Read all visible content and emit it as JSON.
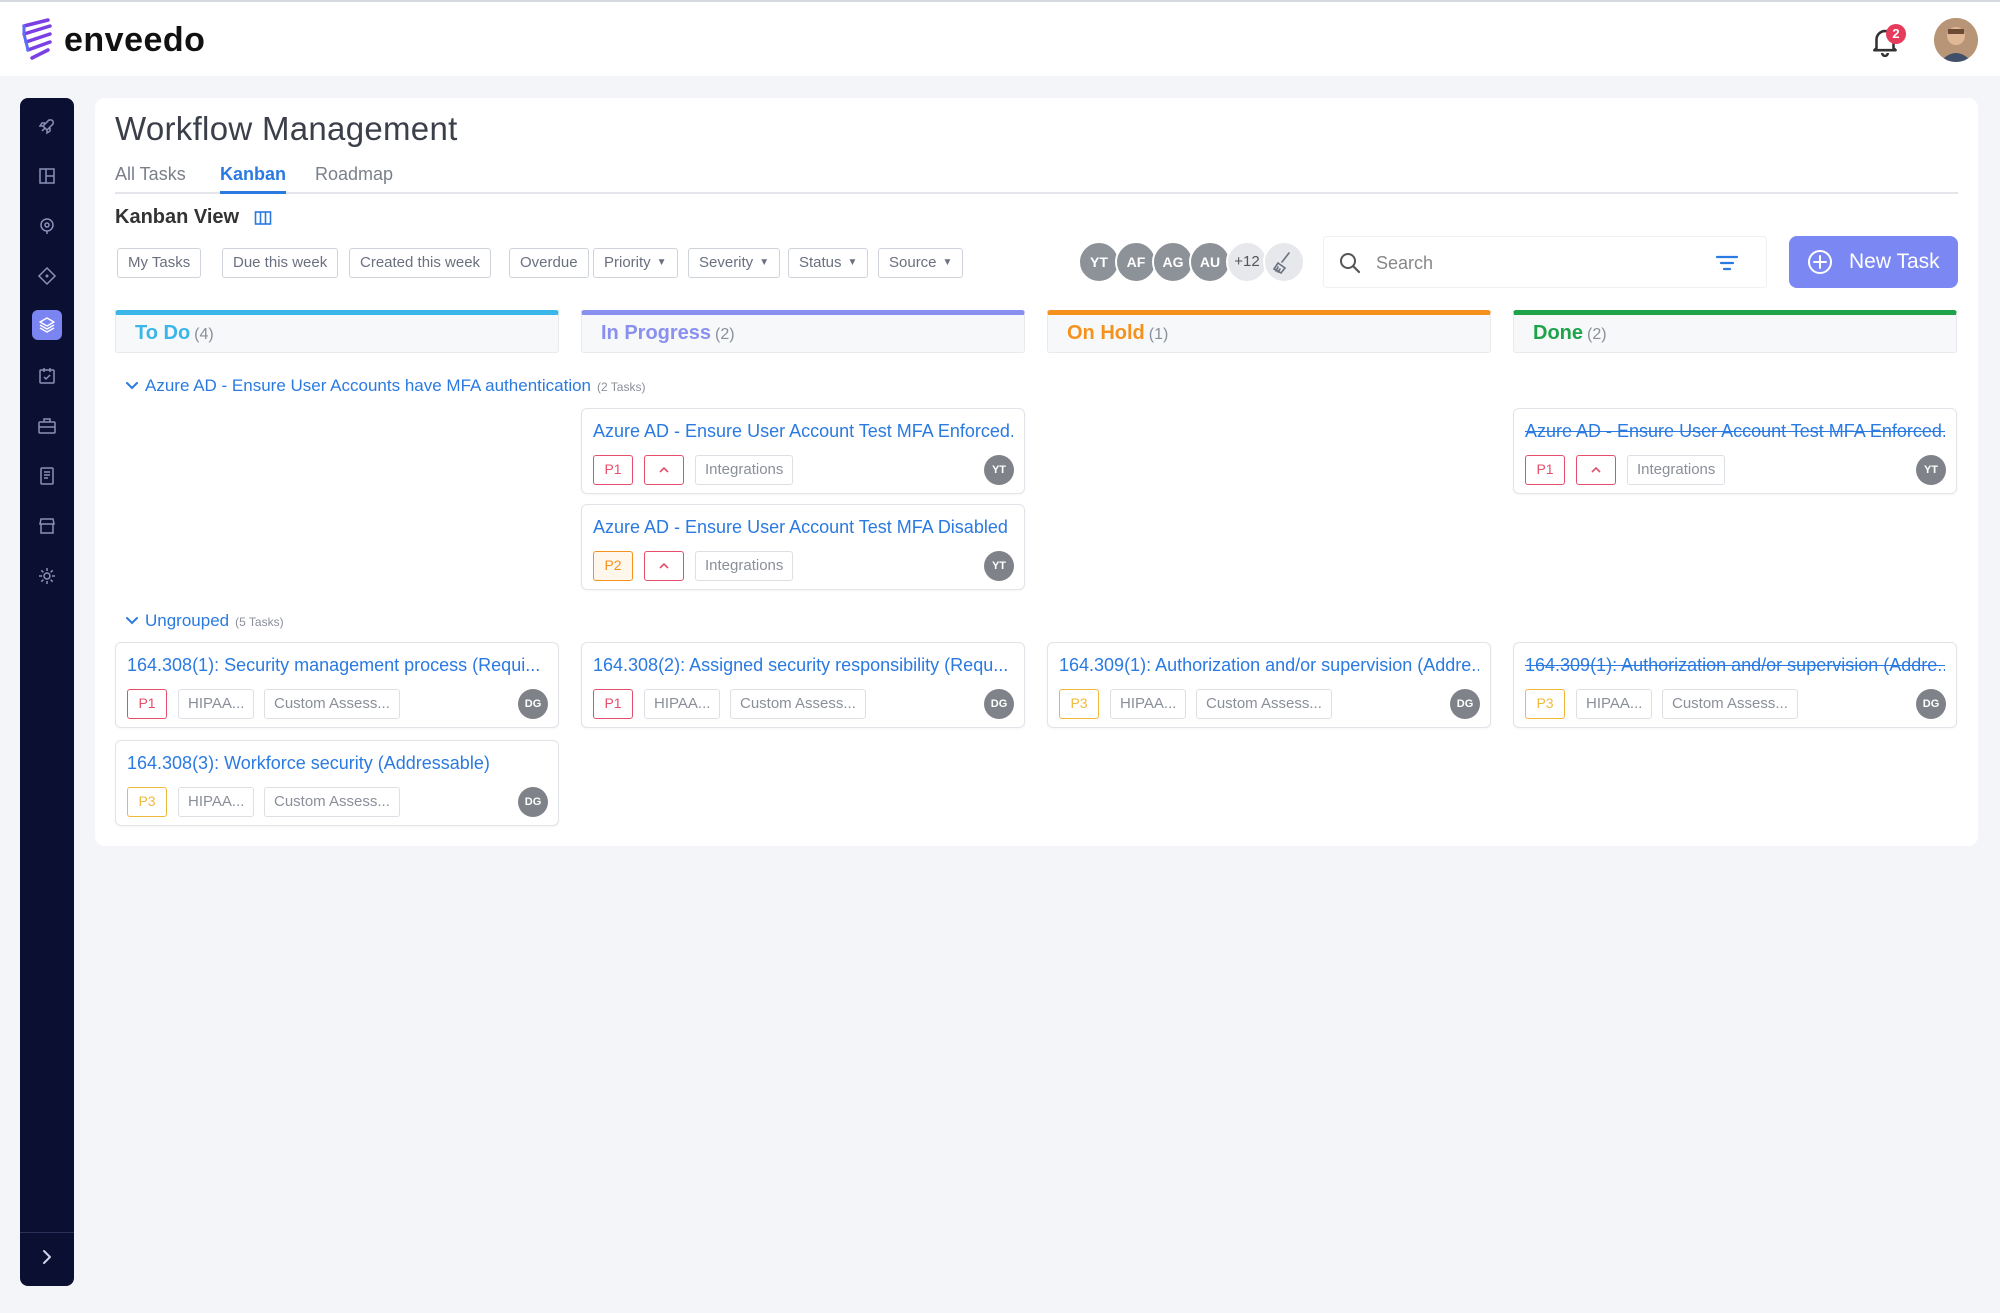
{
  "app": {
    "name": "enveedo"
  },
  "notifications": {
    "count": "2"
  },
  "page": {
    "title": "Workflow Management",
    "view_title": "Kanban View"
  },
  "tabs": [
    "All Tasks",
    "Kanban",
    "Roadmap"
  ],
  "filters": {
    "quick": [
      "My Tasks",
      "Due this week",
      "Created this week",
      "Overdue"
    ],
    "dropdowns": [
      "Priority",
      "Severity",
      "Status",
      "Source"
    ]
  },
  "people": {
    "avatars": [
      "YT",
      "AF",
      "AG",
      "AU"
    ],
    "more": "+12"
  },
  "search": {
    "placeholder": "Search"
  },
  "new_task": {
    "label": "New Task"
  },
  "colors": {
    "todo": "#3ab6e8",
    "in_progress": "#8a90f0",
    "on_hold": "#f5921e",
    "done": "#1fa34a",
    "p1": "#e54f6b",
    "p2": "#f5921e",
    "p3": "#f0b93c",
    "accent": "#2a7ae2"
  },
  "columns": [
    {
      "name": "To Do",
      "count": "(4)"
    },
    {
      "name": "In Progress",
      "count": "(2)"
    },
    {
      "name": "On Hold",
      "count": "(1)"
    },
    {
      "name": "Done",
      "count": "(2)"
    }
  ],
  "groups": [
    {
      "label": "Azure AD - Ensure User Accounts have MFA authentication",
      "count": "(2 Tasks)",
      "cards": [
        {
          "title": "Azure AD - Ensure User Account Test MFA Enforced...",
          "priority": "P1",
          "tags": [
            "Integrations"
          ],
          "assignee": "YT"
        },
        {
          "title": "Azure AD - Ensure User Account Test MFA Disabled h...",
          "priority": "P2",
          "tags": [
            "Integrations"
          ],
          "assignee": "YT"
        },
        {
          "title": "Azure AD - Ensure User Account Test MFA Enforced...",
          "priority": "P1",
          "tags": [
            "Integrations"
          ],
          "assignee": "YT"
        }
      ]
    },
    {
      "label": "Ungrouped",
      "count": "(5 Tasks)",
      "cards": [
        {
          "title": "164.308(1): Security management process (Requi...",
          "priority": "P1",
          "tags": [
            "HIPAA...",
            "Custom Assess..."
          ],
          "assignee": "DG"
        },
        {
          "title": "164.308(3): Workforce security (Addressable)",
          "priority": "P3",
          "tags": [
            "HIPAA...",
            "Custom Assess..."
          ],
          "assignee": "DG"
        },
        {
          "title": "164.308(2): Assigned security responsibility (Requ...",
          "priority": "P1",
          "tags": [
            "HIPAA...",
            "Custom Assess..."
          ],
          "assignee": "DG"
        },
        {
          "title": "164.309(1): Authorization and/or supervision (Addre...",
          "priority": "P3",
          "tags": [
            "HIPAA...",
            "Custom Assess..."
          ],
          "assignee": "DG"
        },
        {
          "title": "164.309(1): Authorization and/or supervision (Addre...",
          "priority": "P3",
          "tags": [
            "HIPAA...",
            "Custom Assess..."
          ],
          "assignee": "DG"
        }
      ]
    }
  ]
}
